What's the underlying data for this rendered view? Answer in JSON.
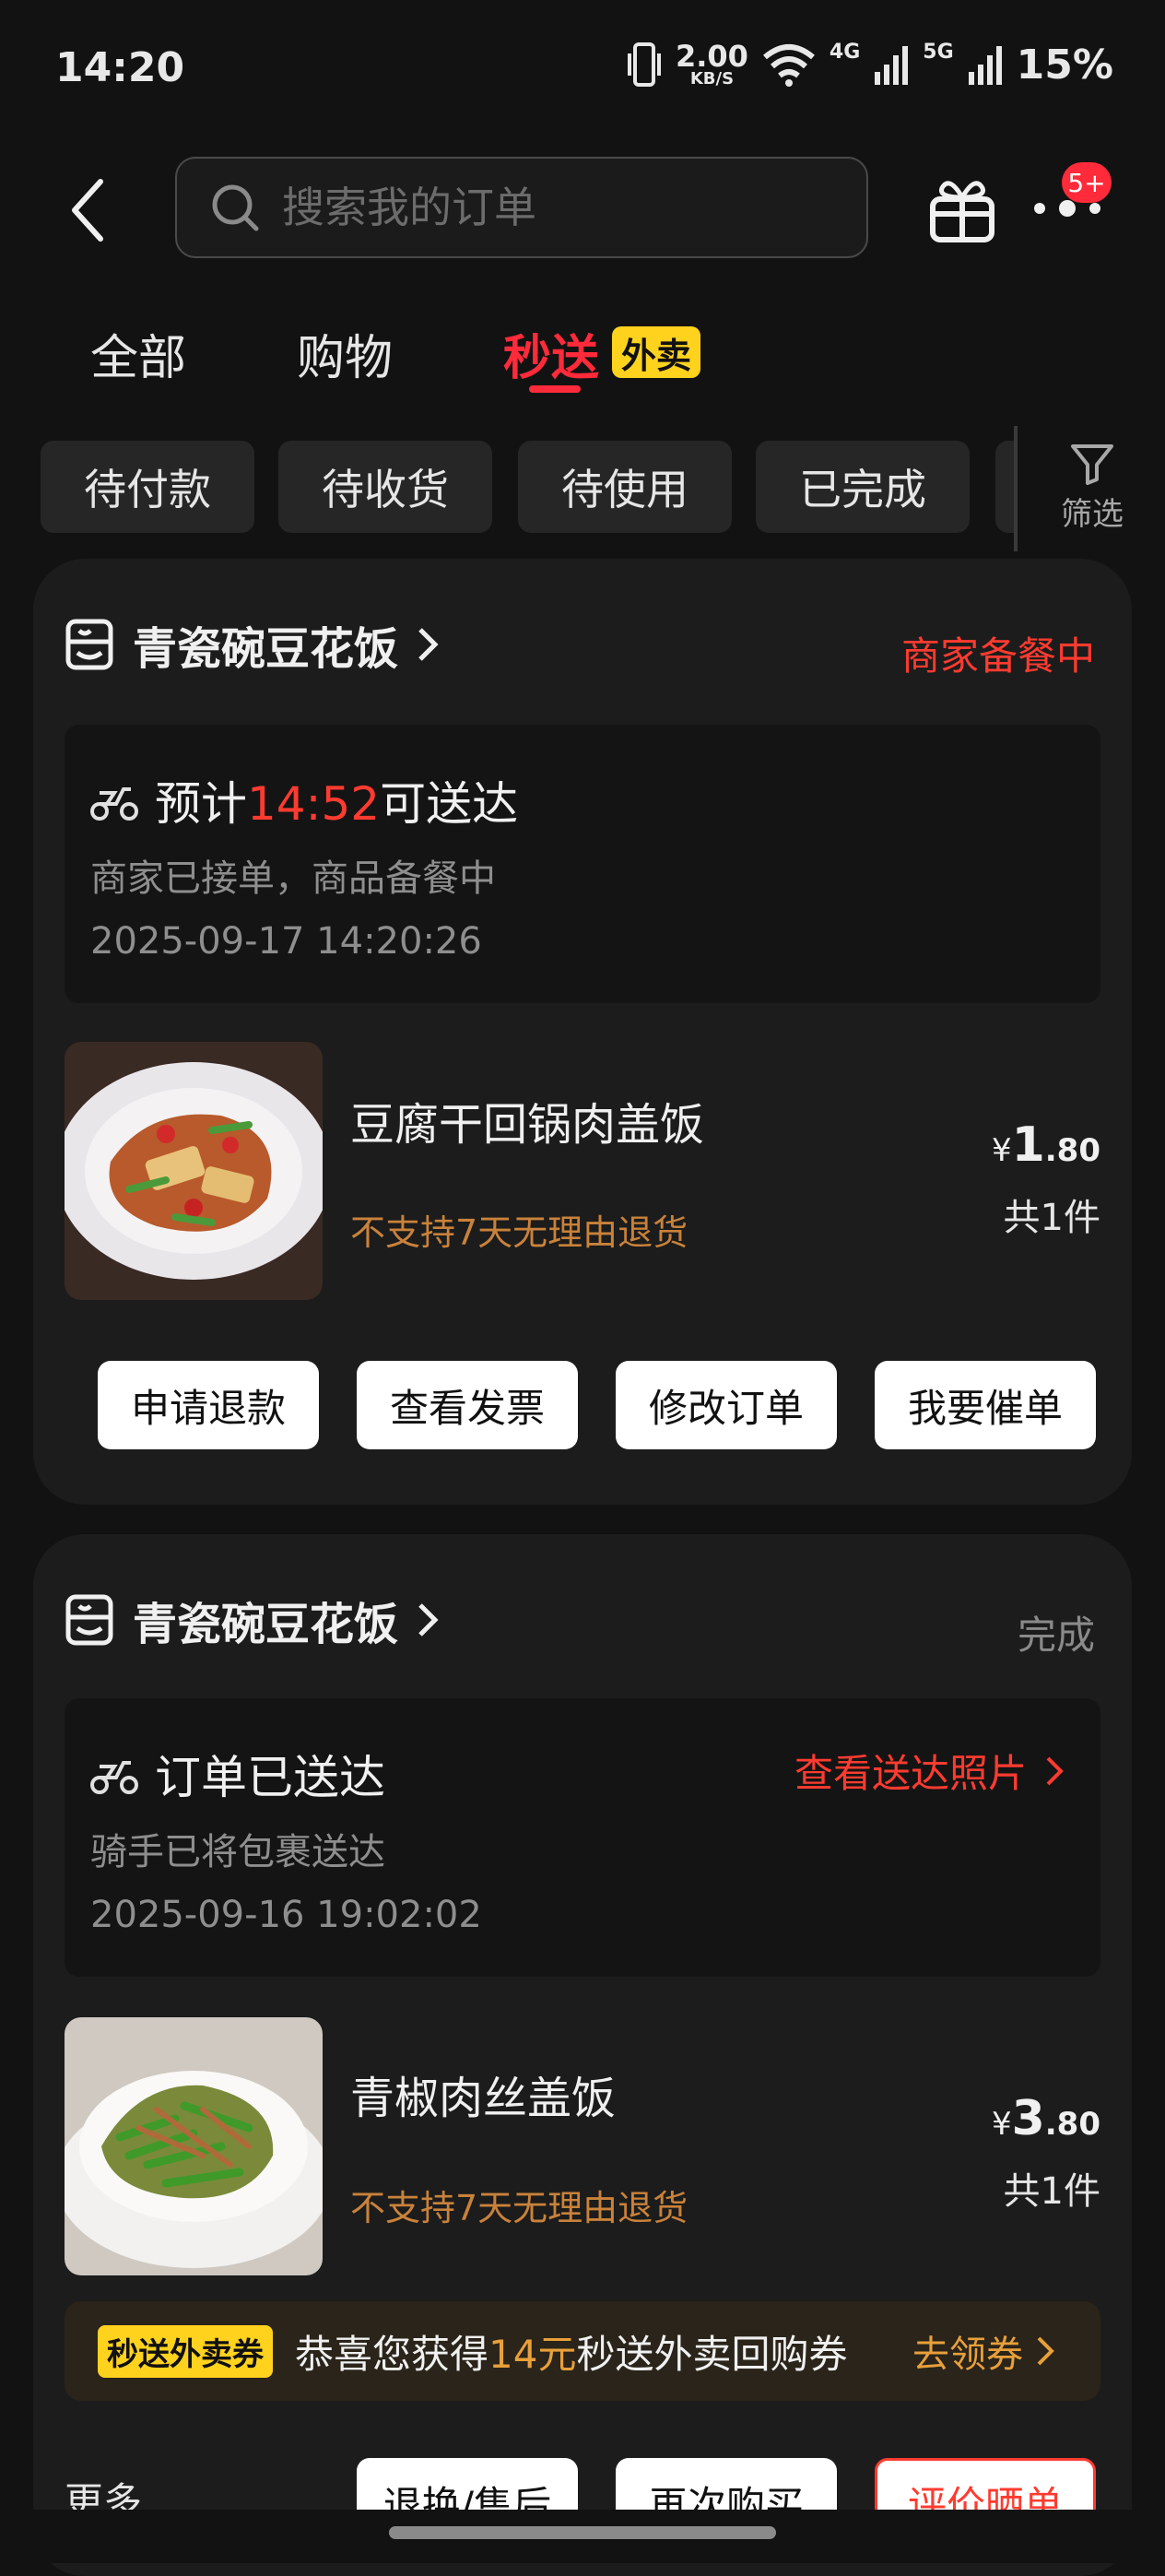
{
  "status_bar": {
    "time": "14:20",
    "net_speed": "2.00",
    "net_unit": "KB/S",
    "net1": "4G",
    "net2": "5G",
    "battery": "15%"
  },
  "search": {
    "placeholder": "搜索我的订单"
  },
  "header": {
    "badge": "5+"
  },
  "tabs": [
    {
      "label": "全部"
    },
    {
      "label": "购物"
    },
    {
      "label": "秒送",
      "tag": "外卖",
      "active": true
    }
  ],
  "filters": [
    "待付款",
    "待收货",
    "待使用",
    "已完成"
  ],
  "filter_button": "筛选",
  "orders": [
    {
      "shop": "青瓷碗豆花饭",
      "status": "商家备餐中",
      "delivery_prefix": "预计",
      "delivery_time": "14:52",
      "delivery_suffix": "可送达",
      "sub": "商家已接单，商品备餐中",
      "timestamp": "2025-09-17 14:20:26",
      "item": {
        "name": "豆腐干回锅肉盖饭",
        "note": "不支持7天无理由退货",
        "currency": "¥",
        "price_int": "1",
        "price_dec": ".80",
        "qty": "共1件"
      },
      "buttons": [
        "申请退款",
        "查看发票",
        "修改订单",
        "我要催单"
      ]
    },
    {
      "shop": "青瓷碗豆花饭",
      "status": "完成",
      "delivery_text": "订单已送达",
      "photo_link": "查看送达照片",
      "sub": "骑手已将包裹送达",
      "timestamp": "2025-09-16 19:02:02",
      "item": {
        "name": "青椒肉丝盖饭",
        "note": "不支持7天无理由退货",
        "currency": "¥",
        "price_int": "3",
        "price_dec": ".80",
        "qty": "共1件"
      },
      "coupon": {
        "tag": "秒送外卖券",
        "text_prefix": "恭喜您获得",
        "amount": "14元",
        "text_suffix": "秒送外卖回购券",
        "cta": "去领券"
      },
      "more": "更多",
      "buttons": [
        "退换/售后",
        "再次购买",
        "评价晒单"
      ]
    }
  ],
  "colors": {
    "accent_red": "#ff3b30",
    "tag_yellow": "#ffd21e",
    "note_orange": "#c9823a"
  }
}
